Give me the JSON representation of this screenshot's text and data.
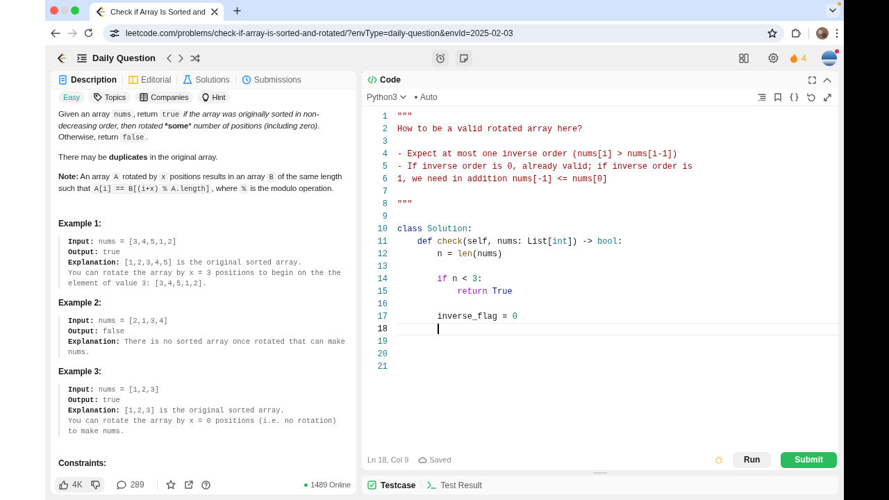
{
  "browser": {
    "tab_title": "Check if Array Is Sorted and",
    "url": "leetcode.com/problems/check-if-array-is-sorted-and-rotated/?envType=daily-question&envId=2025-02-03"
  },
  "app_bar": {
    "title": "Daily Question",
    "streak": "4"
  },
  "description_panel": {
    "tabs": [
      {
        "label": "Description",
        "selected": true
      },
      {
        "label": "Editorial",
        "selected": false
      },
      {
        "label": "Solutions",
        "selected": false
      },
      {
        "label": "Submissions",
        "selected": false
      }
    ],
    "tags": [
      {
        "label": "Easy",
        "kind": "difficulty"
      },
      {
        "label": "Topics",
        "kind": "topics"
      },
      {
        "label": "Companies",
        "kind": "companies"
      },
      {
        "label": "Hint",
        "kind": "hint"
      }
    ],
    "paragraphs": [
      [
        {
          "kind": "text",
          "text": "Given an array "
        },
        {
          "kind": "code",
          "text": "nums"
        },
        {
          "kind": "text",
          "text": ", return "
        },
        {
          "kind": "code",
          "text": "true"
        },
        {
          "kind": "text",
          "text": " *if the array was originally sorted in non-decreasing order, then rotated* ***some*** *number of positions (including zero)*. Otherwise, return "
        },
        {
          "kind": "code",
          "text": "false"
        },
        {
          "kind": "text",
          "text": "."
        }
      ],
      [
        {
          "kind": "text",
          "text": "There may be **duplicates** in the original array."
        }
      ],
      [
        {
          "kind": "text",
          "text": "**Note:** An array "
        },
        {
          "kind": "code",
          "text": "A"
        },
        {
          "kind": "text",
          "text": " rotated by "
        },
        {
          "kind": "code",
          "text": "x"
        },
        {
          "kind": "text",
          "text": " positions results in an array "
        },
        {
          "kind": "code",
          "text": "B"
        },
        {
          "kind": "text",
          "text": " of the same length such that "
        },
        {
          "kind": "code",
          "text": "A[i] == B[(i+x) % A.length]"
        },
        {
          "kind": "text",
          "text": ", where "
        },
        {
          "kind": "code",
          "text": "%"
        },
        {
          "kind": "text",
          "text": " is the modulo operation."
        }
      ]
    ],
    "examples": [
      {
        "title": "Example 1:",
        "lines": [
          "**Input:** nums = [3,4,5,1,2]",
          "**Output:** true",
          "**Explanation:** [1,2,3,4,5] is the original sorted array.",
          "You can rotate the array by x = 3 positions to begin on the the element of value 3: [3,4,5,1,2]."
        ]
      },
      {
        "title": "Example 2:",
        "lines": [
          "**Input:** nums = [2,1,3,4]",
          "**Output:** false",
          "**Explanation:** There is no sorted array once rotated that can make nums."
        ]
      },
      {
        "title": "Example 3:",
        "lines": [
          "**Input:** nums = [1,2,3]",
          "**Output:** true",
          "**Explanation:** [1,2,3] is the original sorted array.",
          "You can rotate the array by x = 0 positions (i.e. no rotation) to make nums."
        ]
      }
    ],
    "constraints_heading": "Constraints:",
    "footer": {
      "likes": "4K",
      "comments": "289",
      "online": "1489 Online"
    }
  },
  "code_panel": {
    "tab": "Code",
    "language": "Python3",
    "mode": "Auto",
    "lines": [
      {
        "number": "1",
        "current": false,
        "tokens": [
          {
            "kind": "string",
            "text": "\"\"\""
          }
        ]
      },
      {
        "number": "2",
        "current": false,
        "tokens": [
          {
            "kind": "string",
            "text": "How to be a valid rotated array here?"
          }
        ]
      },
      {
        "number": "3",
        "current": false
      },
      {
        "number": "4",
        "current": false,
        "tokens": [
          {
            "kind": "string",
            "text": "- Expect at most one inverse order (nums[i] > nums[i-1])"
          }
        ]
      },
      {
        "number": "5",
        "current": false,
        "tokens": [
          {
            "kind": "string",
            "text": "- If inverse order is 0, already valid; if inverse order is"
          }
        ]
      },
      {
        "number": "6",
        "current": false,
        "tokens": [
          {
            "kind": "string",
            "text": "1, we need in addition nums[-1] <= nums[0]"
          }
        ]
      },
      {
        "number": "7",
        "current": false
      },
      {
        "number": "8",
        "current": false,
        "tokens": [
          {
            "kind": "string",
            "text": "\"\"\""
          }
        ]
      },
      {
        "number": "9",
        "current": false
      },
      {
        "number": "10",
        "current": false,
        "tokens": [
          {
            "kind": "keyword",
            "text": "class"
          },
          {
            "kind": "class",
            "text": " Solution"
          },
          {
            "kind": "plain",
            "text": ":"
          }
        ]
      },
      {
        "number": "11",
        "current": false,
        "tokens": [
          {
            "kind": "keyword",
            "text": "    def"
          },
          {
            "kind": "function",
            "text": " check"
          },
          {
            "kind": "plain",
            "text": "(self, nums: List["
          },
          {
            "kind": "type",
            "text": "int"
          },
          {
            "kind": "plain",
            "text": "]) -> "
          },
          {
            "kind": "type",
            "text": "bool"
          },
          {
            "kind": "plain",
            "text": ":"
          }
        ]
      },
      {
        "number": "12",
        "current": false,
        "tokens": [
          {
            "kind": "plain",
            "text": "        n = "
          },
          {
            "kind": "function",
            "text": "len"
          },
          {
            "kind": "plain",
            "text": "(nums)"
          }
        ]
      },
      {
        "number": "13",
        "current": false
      },
      {
        "number": "14",
        "current": false,
        "tokens": [
          {
            "kind": "control",
            "text": "        if"
          },
          {
            "kind": "plain",
            "text": " n < "
          },
          {
            "kind": "number",
            "text": "3"
          },
          {
            "kind": "plain",
            "text": ":"
          }
        ]
      },
      {
        "number": "15",
        "current": false,
        "tokens": [
          {
            "kind": "control",
            "text": "            return"
          },
          {
            "kind": "keyword",
            "text": " True"
          }
        ]
      },
      {
        "number": "16",
        "current": false
      },
      {
        "number": "17",
        "current": false,
        "tokens": [
          {
            "kind": "plain",
            "text": "        inverse_flag = "
          },
          {
            "kind": "number",
            "text": "0"
          }
        ]
      },
      {
        "number": "18",
        "current": true
      },
      {
        "number": "19",
        "current": false
      },
      {
        "number": "20",
        "current": false
      },
      {
        "number": "21",
        "current": false
      }
    ],
    "cursor_position": "Ln 18, Col 9",
    "save_status": "Saved",
    "run_button": "Run",
    "submit_button": "Submit"
  },
  "bottom_tabs": [
    {
      "label": "Testcase",
      "selected": true
    },
    {
      "label": "Test Result",
      "selected": false
    }
  ]
}
